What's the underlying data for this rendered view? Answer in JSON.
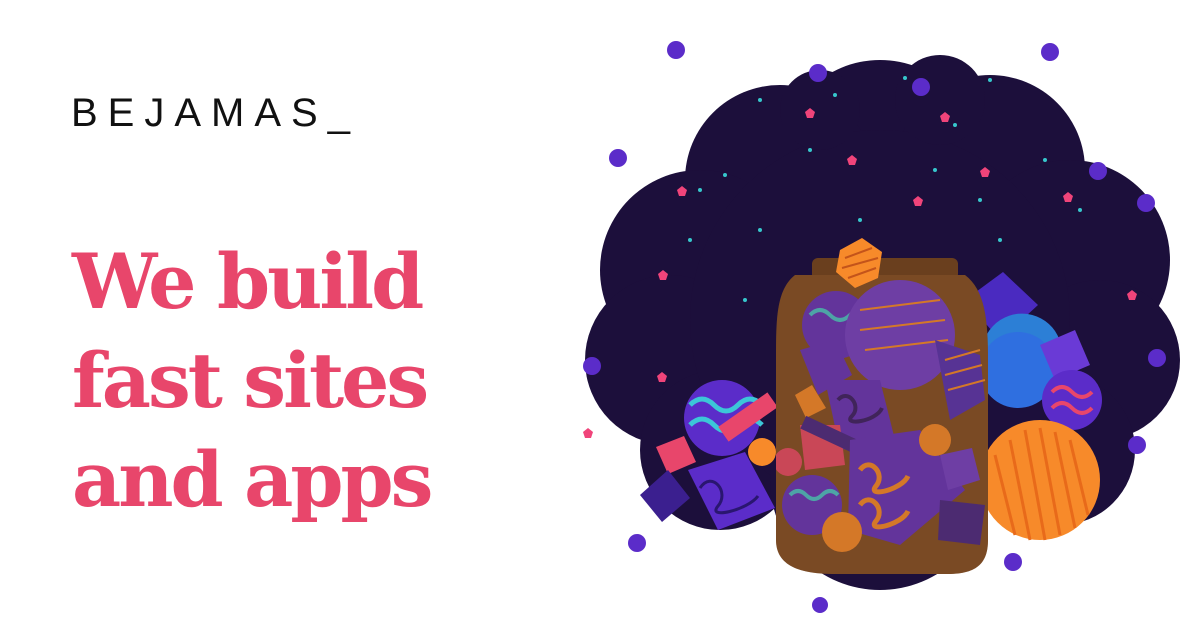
{
  "brand": {
    "logo_text": "BEJAMAS_"
  },
  "hero": {
    "lines": [
      "We build",
      "fast sites",
      "and apps"
    ]
  },
  "colors": {
    "accent": "#e8466b",
    "logo": "#111111",
    "night_sky": "#1c0f3b",
    "jar": "#7a4a25",
    "orange": "#f78a2a",
    "purple": "#5b2cc9",
    "teal": "#3cc6d8"
  },
  "illustration": {
    "icon": "jar-of-shapes-illustration"
  }
}
